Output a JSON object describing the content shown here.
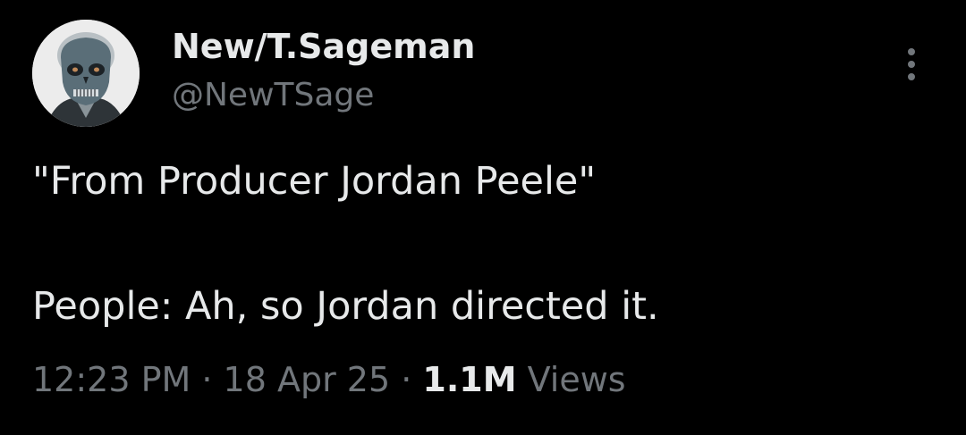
{
  "author": {
    "name": "New/T.Sageman",
    "handle": "@NewTSage",
    "avatar_icon": "masked-figure-avatar"
  },
  "tweet": {
    "line1": "\"From Producer Jordan Peele\"",
    "line2": "People: Ah, so Jordan directed it."
  },
  "meta": {
    "time": "12:23 PM",
    "sep1": " · ",
    "date": "18 Apr 25",
    "sep2": " · ",
    "views_count": "1.1M",
    "views_label": " Views"
  },
  "menu": {
    "icon": "more-vertical-icon"
  },
  "colors": {
    "background": "#000000",
    "primary_text": "#e7e9ea",
    "secondary_text": "#71767b"
  }
}
